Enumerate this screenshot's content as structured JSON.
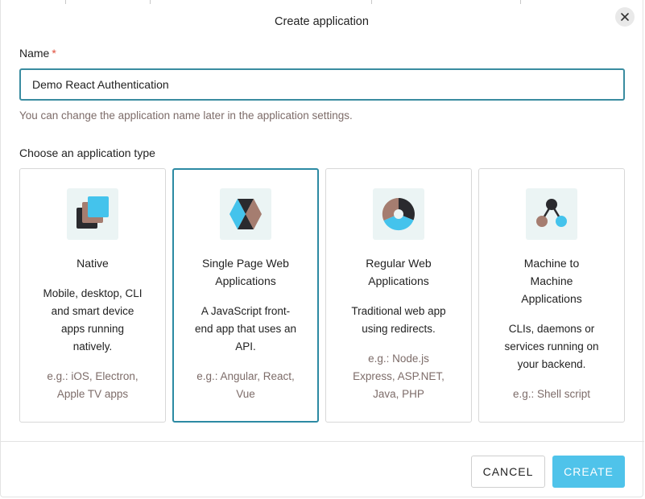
{
  "dialog": {
    "title": "Create application",
    "close_label": "close"
  },
  "name_field": {
    "label": "Name",
    "required_marker": "*",
    "value": "Demo React Authentication",
    "hint": "You can change the application name later in the application settings."
  },
  "app_types": {
    "heading": "Choose an application type",
    "selected": "Single Page Web Applications",
    "cards": [
      {
        "icon": "native-app-icon",
        "title_lines": [
          "Native"
        ],
        "desc_lines": [
          "Mobile, desktop, CLI",
          "and smart device",
          "apps running",
          "natively."
        ],
        "example_lines": [
          "e.g.: iOS, Electron,",
          "Apple TV apps"
        ]
      },
      {
        "icon": "spa-app-icon",
        "title_lines": [
          "Single Page Web",
          "Applications"
        ],
        "desc_lines": [
          "A JavaScript front-",
          "end app that uses an",
          "API."
        ],
        "example_lines": [
          "e.g.: Angular, React,",
          "Vue"
        ]
      },
      {
        "icon": "regular-web-app-icon",
        "title_lines": [
          "Regular Web",
          "Applications"
        ],
        "desc_lines": [
          "Traditional web app",
          "using redirects."
        ],
        "example_lines": [
          "e.g.: Node.js",
          "Express, ASP.NET,",
          "Java, PHP"
        ]
      },
      {
        "icon": "machine-to-machine-icon",
        "title_lines": [
          "Machine to",
          "Machine",
          "Applications"
        ],
        "desc_lines": [
          "CLIs, daemons or",
          "services running on",
          "your backend."
        ],
        "example_lines": [
          "e.g.: Shell script"
        ]
      }
    ]
  },
  "footer": {
    "cancel_label": "CANCEL",
    "create_label": "CREATE"
  },
  "colors": {
    "accent": "#2c8aa3",
    "create_button": "#4fc3ea",
    "muted_text": "#7d6c69",
    "icon_bg": "#ebf4f4",
    "icon_brown": "#a57d70",
    "icon_dark": "#2a2a2e",
    "icon_blue": "#44c3ec"
  }
}
